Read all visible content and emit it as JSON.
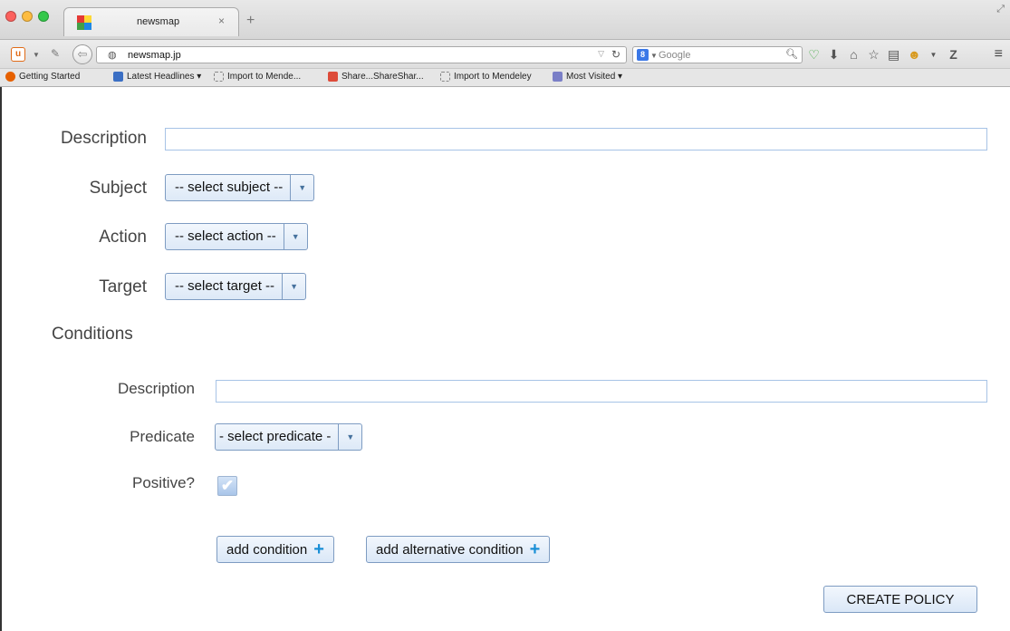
{
  "browser": {
    "tab_title": "newsmap",
    "tab_close": "×",
    "new_tab": "+",
    "url": "newsmap.jp",
    "search_placeholder": "Google",
    "search_engine_badge": "8",
    "bookmarks": [
      {
        "label": "Getting Started",
        "icon": "firefox-icon",
        "color": "#e66000"
      },
      {
        "label": "Latest Headlines ▾",
        "icon": "rss-icon",
        "color": "#3b6fc4"
      },
      {
        "label": "Import to Mende...",
        "icon": "bookmark-icon",
        "color": ""
      },
      {
        "label": "Share...ShareShar...",
        "icon": "google-plus-icon",
        "color": "#dd4b39"
      },
      {
        "label": "Import to Mendeley",
        "icon": "bookmark-icon",
        "color": ""
      },
      {
        "label": "Most Visited ▾",
        "icon": "folder-icon",
        "color": "#7a7fc7"
      }
    ]
  },
  "form": {
    "description_label": "Description",
    "description_value": "",
    "subject_label": "Subject",
    "subject_select": "-- select subject --",
    "action_label": "Action",
    "action_select": "-- select action --",
    "target_label": "Target",
    "target_select": "-- select target --",
    "conditions_heading": "Conditions",
    "condition": {
      "description_label": "Description",
      "description_value": "",
      "predicate_label": "Predicate",
      "predicate_select": "- select predicate -",
      "positive_label": "Positive?",
      "positive_checked": true
    },
    "add_condition_label": "add condition",
    "add_alternative_label": "add alternative condition",
    "plus_glyph": "+",
    "create_policy_label": "CREATE POLICY"
  },
  "colors": {
    "button_border": "#7e9cc2",
    "input_border": "#a7c3e6",
    "plus_accent": "#1a8fd6"
  }
}
